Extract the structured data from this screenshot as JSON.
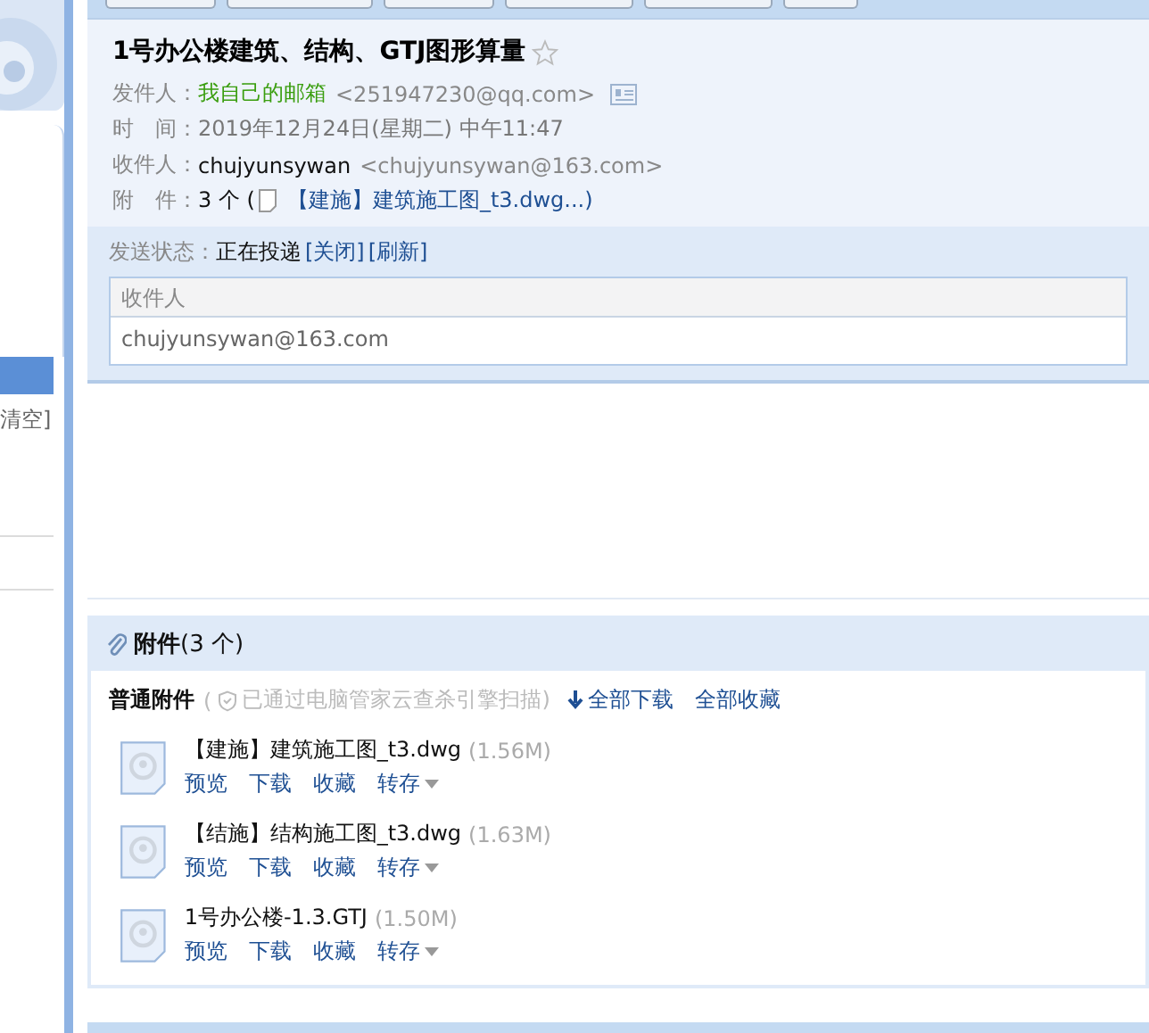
{
  "sidebar": {
    "clear_link": "清空]"
  },
  "message": {
    "title": "1号办公楼建筑、结构、GTJ图形算量",
    "starred": false,
    "sender": {
      "label": "发件人：",
      "name": "我自己的邮箱",
      "address": "<251947230@qq.com>"
    },
    "time": {
      "label": "时　间：",
      "value": "2019年12月24日(星期二) 中午11:47"
    },
    "recipient": {
      "label": "收件人：",
      "name": "chujyunsywan",
      "address": "<chujyunsywan@163.com>"
    },
    "attachment_summary": {
      "label": "附　件：",
      "count": "3 个 (",
      "first_file": "【建施】建筑施工图_t3.dwg...)"
    }
  },
  "send_status": {
    "label": "发送状态：",
    "value": "正在投递",
    "links": [
      "[关闭]",
      "[刷新]"
    ],
    "table": {
      "columns": [
        "收件人"
      ],
      "rows": [
        [
          "chujyunsywan@163.com"
        ]
      ]
    }
  },
  "attachments": {
    "title": "**附件**(3 个)",
    "section_label": "普通附件",
    "scan_prefix": "(",
    "scan_note": "已通过电脑管家云查杀引擎扫描)",
    "actions": [
      "全部下载",
      "全部收藏"
    ],
    "files": [
      {
        "name": "【建施】建筑施工图_t3.dwg",
        "size": "(1.56M)",
        "actions": [
          "预览",
          "下载",
          "收藏",
          "转存"
        ]
      },
      {
        "name": "【结施】结构施工图_t3.dwg",
        "size": "(1.63M)",
        "actions": [
          "预览",
          "下载",
          "收藏",
          "转存"
        ]
      },
      {
        "name": "1号办公楼-1.3.GTJ",
        "size": "(1.50M)",
        "actions": [
          "预览",
          "下载",
          "收藏",
          "转存"
        ]
      }
    ]
  }
}
